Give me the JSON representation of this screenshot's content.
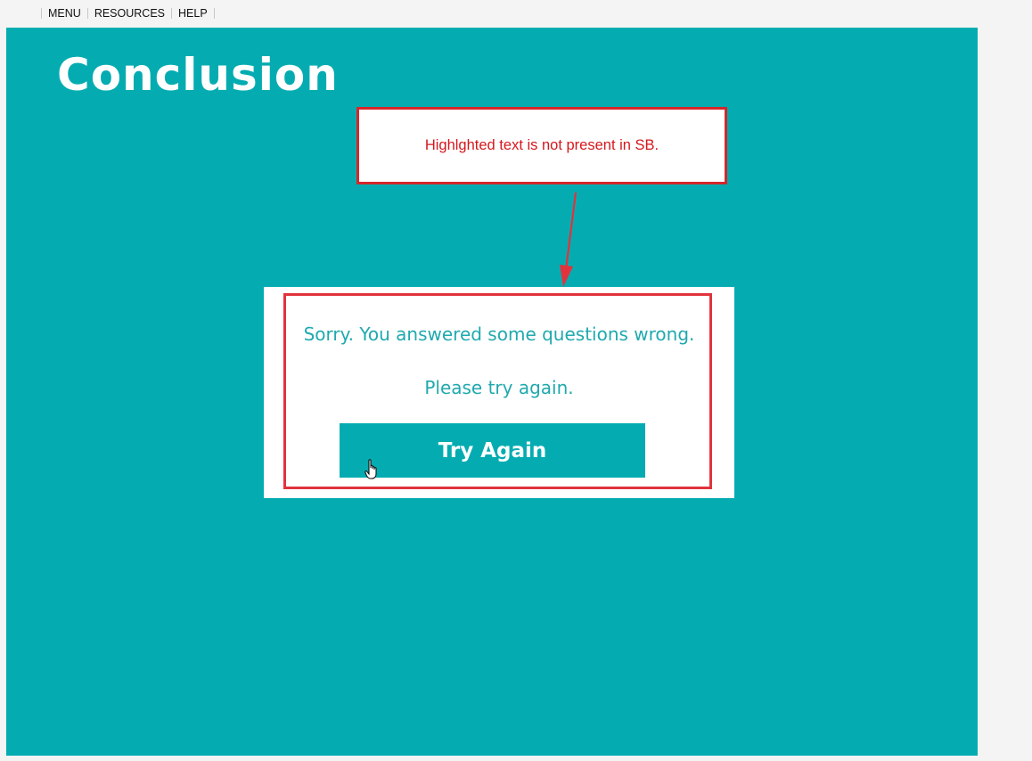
{
  "topnav": {
    "menu_label": "MENU",
    "resources_label": "RESOURCES",
    "help_label": "HELP"
  },
  "slide": {
    "title": "Conclusion",
    "background_color": "#04acb1"
  },
  "annotation": {
    "text": "Highlghted text is not present in SB.",
    "color": "#d5262b"
  },
  "feedback": {
    "line1": "Sorry. You answered some questions wrong.",
    "line2": "Please try again.",
    "button_label": "Try Again"
  },
  "cursor_icon": "hand-pointer-icon"
}
